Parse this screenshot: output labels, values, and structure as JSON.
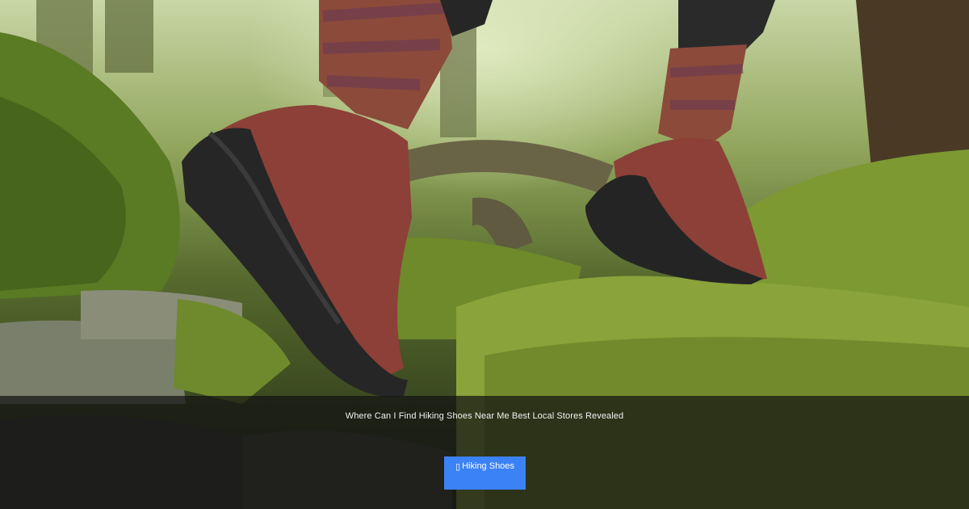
{
  "hero": {
    "image_description_icon": "hiking-boots-photo"
  },
  "headline": "Where Can I Find Hiking Shoes Near Me Best Local Stores Revealed",
  "tag_button": {
    "icon": "tag-icon",
    "glyph": "▯",
    "label": "Hiking Shoes",
    "color": "#3b82f6"
  }
}
